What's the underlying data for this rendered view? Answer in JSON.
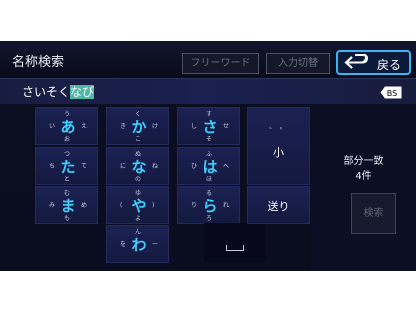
{
  "header": {
    "title": "名称検索",
    "free_word": "フリーワード",
    "input_switch": "入力切替",
    "back": "戻る"
  },
  "input": {
    "text_plain": "さいそく",
    "text_highlight": "なび",
    "bs": "BS"
  },
  "keys": [
    {
      "name": "a",
      "top": "う",
      "left": "い",
      "main": "あ",
      "right": "え",
      "bottom": "お"
    },
    {
      "name": "ka",
      "top": "く",
      "left": "き",
      "main": "か",
      "right": "け",
      "bottom": "こ"
    },
    {
      "name": "sa",
      "top": "す",
      "left": "し",
      "main": "さ",
      "right": "せ",
      "bottom": "そ"
    },
    {
      "name": "ta",
      "top": "つ",
      "left": "ち",
      "main": "た",
      "right": "て",
      "bottom": "と"
    },
    {
      "name": "na",
      "top": "ぬ",
      "left": "に",
      "main": "な",
      "right": "ね",
      "bottom": "の"
    },
    {
      "name": "ha",
      "top": "ふ",
      "left": "ひ",
      "main": "は",
      "right": "へ",
      "bottom": "ほ"
    },
    {
      "name": "ma",
      "top": "む",
      "left": "み",
      "main": "ま",
      "right": "め",
      "bottom": "も"
    },
    {
      "name": "ya",
      "top": "ゆ",
      "left": "(",
      "main": "や",
      "right": ")",
      "bottom": "よ"
    },
    {
      "name": "ra",
      "top": "る",
      "left": "り",
      "main": "ら",
      "right": "れ",
      "bottom": "ろ"
    },
    {
      "name": "wa",
      "top": "ん",
      "left": "を",
      "main": "わ",
      "right": "ー",
      "bottom": ""
    }
  ],
  "side_keys": {
    "small_top": "゛ ゜",
    "small": "小",
    "send": "送り"
  },
  "match": {
    "label": "部分一致",
    "count": "4件"
  },
  "search": "検索"
}
